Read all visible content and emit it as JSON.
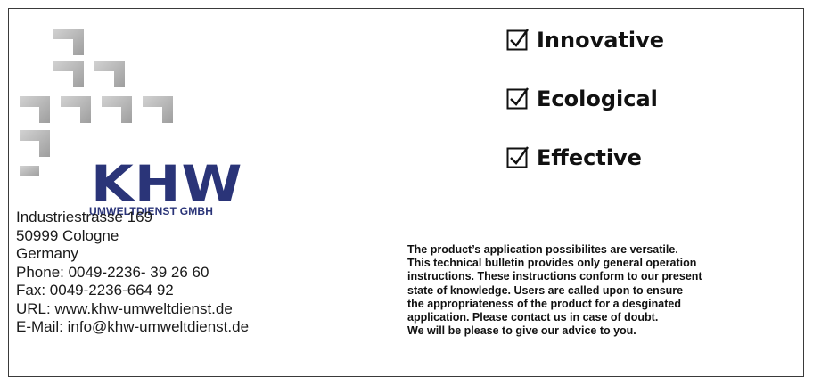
{
  "logo": {
    "brand": "KHW",
    "subtitle": "UMWELTDIENST GMBH",
    "brand_color": "#2a3478",
    "shape_color": "#b9b9b9"
  },
  "address": {
    "lines": [
      "Industriestrasse 169",
      "50999 Cologne",
      "Germany",
      "Phone: 0049-2236- 39 26 60",
      "Fax: 0049-2236-664 92",
      "URL: www.khw-umweltdienst.de",
      "E-Mail: info@khw-umweltdienst.de"
    ]
  },
  "features": [
    {
      "icon": "checked-box-icon",
      "label": "Innovative"
    },
    {
      "icon": "checked-box-icon",
      "label": "Ecological"
    },
    {
      "icon": "checked-box-icon",
      "label": "Effective"
    }
  ],
  "notice": {
    "lines": [
      "The product’s application possibilites are versatile.",
      "This technical bulletin provides only general operation",
      "instructions. These instructions conform to our present",
      "state of knowledge. Users are called upon to ensure",
      "the appropriateness of the product for a desginated",
      "application. Please contact us in case of doubt.",
      "We will be please to give our advice to you."
    ]
  }
}
